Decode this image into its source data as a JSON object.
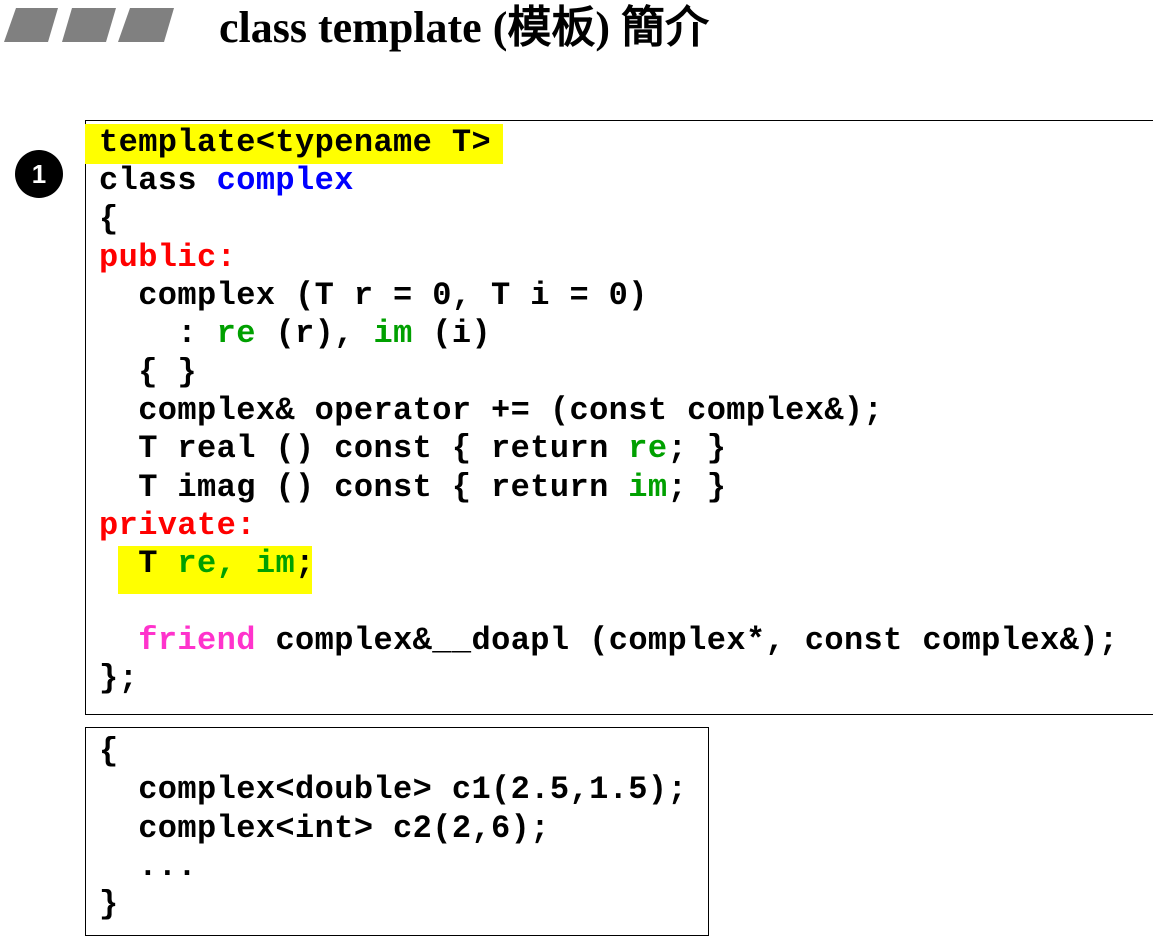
{
  "header": {
    "title": "class template (模板) 簡介",
    "decor_color": "#808080"
  },
  "badge": {
    "label": "1"
  },
  "colors": {
    "highlight": "#ffff00",
    "type_name": "#0000ff",
    "member": "#00a000",
    "access": "#ff0000",
    "friend": "#ff33cc"
  },
  "class_code": {
    "l0": "template<typename T>",
    "l1_a": "class ",
    "l1_b": "complex",
    "l2": "{",
    "l3": "public:",
    "l4": "  complex (T r = 0, T i = 0)",
    "l5_a": "    : ",
    "l5_b": "re",
    "l5_c": " (r), ",
    "l5_d": "im",
    "l5_e": " (i)",
    "l6": "  { }",
    "l7": "  complex& operator += (const complex&);",
    "l8_a": "  T real () const { return ",
    "l8_b": "re",
    "l8_c": "; }",
    "l9_a": "  T imag () const { return ",
    "l9_b": "im",
    "l9_c": "; }",
    "l10": "private:",
    "l11_a": "  T ",
    "l11_b": "re",
    "l11_c": ", ",
    "l11_d": "im",
    "l11_e": ";",
    "l12": "",
    "l13_a": "  ",
    "l13_b": "friend",
    "l13_c": " complex&",
    "l13_d": "__",
    "l13_e": "doapl (complex*, const complex&);",
    "l14": "};"
  },
  "usage_code": {
    "l0": "{",
    "l1": "  complex<double> c1(2.5,1.5);",
    "l2": "  complex<int> c2(2,6);",
    "l3": "  ...",
    "l4": "}"
  }
}
